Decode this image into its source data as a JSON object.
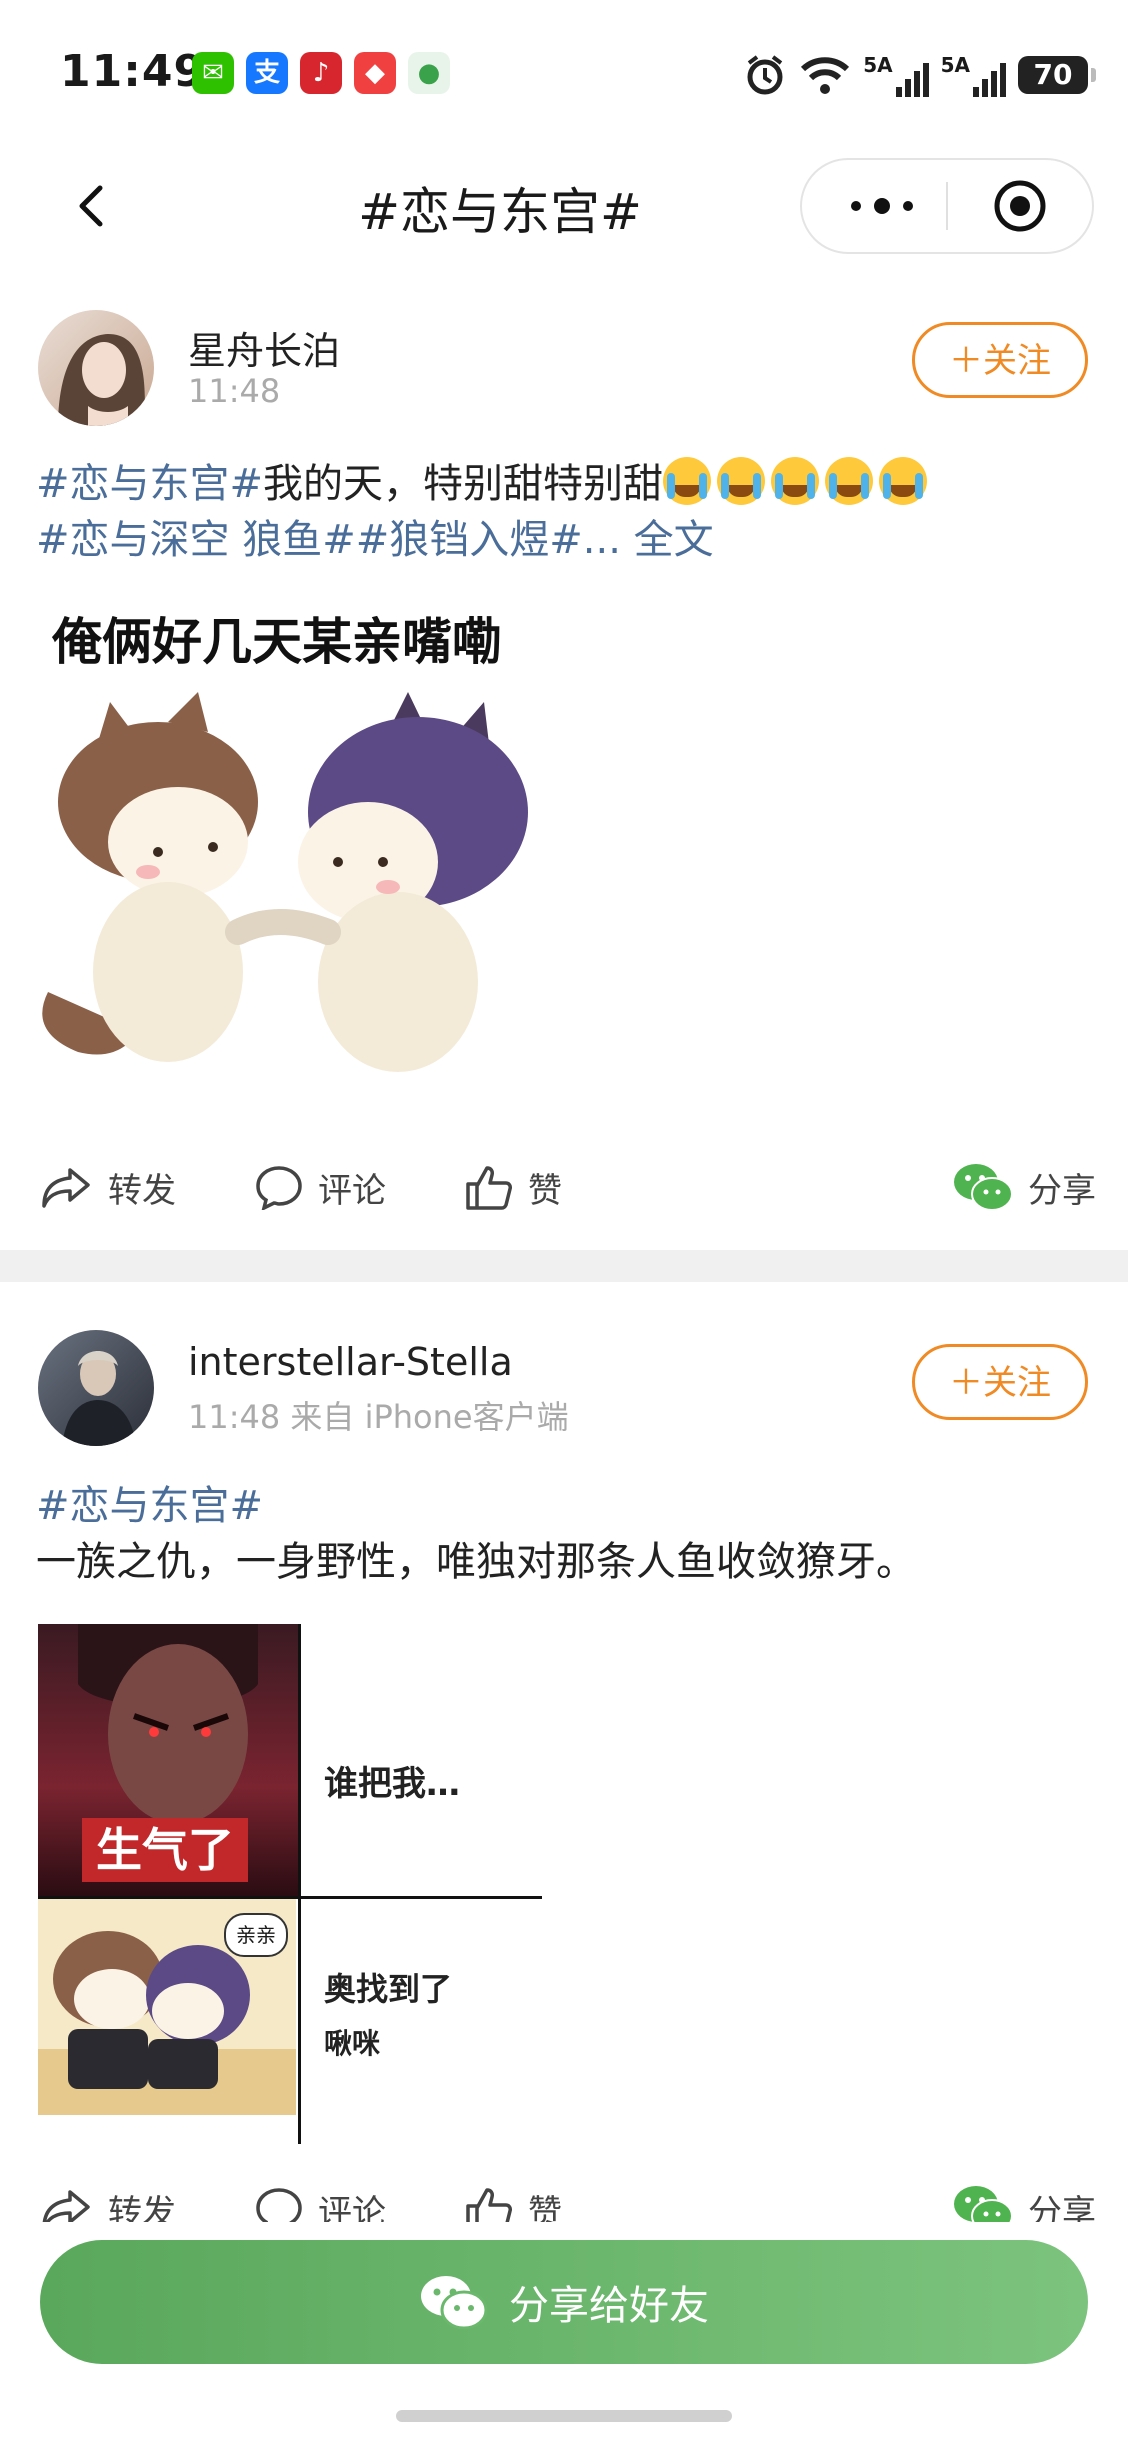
{
  "status_bar": {
    "time": "11:49",
    "signal1": "5A",
    "signal2": "5A",
    "battery": "70"
  },
  "nav": {
    "title": "#恋与东宫#"
  },
  "posts": [
    {
      "username": "星舟长泊",
      "meta": "11:48",
      "follow": "＋关注",
      "tag1": "#恋与东宫#",
      "body": "我的天，特别甜特别甜",
      "tag2": "#恋与深空 狼鱼##狼铛入煜#",
      "more": "... 全文",
      "image_caption": "俺俩好几天某亲嘴嘞",
      "actions": {
        "repost": "转发",
        "comment": "评论",
        "like": "赞",
        "share": "分享"
      }
    },
    {
      "username": "interstellar-Stella",
      "meta": "11:48  来自 iPhone客户端",
      "follow": "＋关注",
      "tag1": "#恋与东宫#",
      "body": "一族之仇，一身野性，唯独对那条人鱼收敛獠牙。",
      "meme": {
        "badge": "生气了",
        "line1": "谁把我…",
        "sticker": "亲亲",
        "line2": "奥找到了",
        "line3": "啾咪"
      },
      "actions": {
        "repost": "转发",
        "comment": "评论",
        "like": "赞",
        "share": "分享"
      }
    }
  ],
  "bottom": {
    "share_label": "分享给好友"
  },
  "colors": {
    "tag": "#4a6e99",
    "follow": "#f08a24",
    "share_green": "#5aa85c"
  }
}
